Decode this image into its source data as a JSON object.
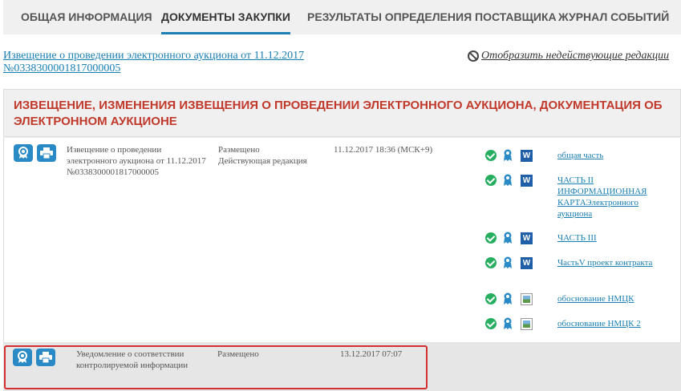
{
  "tabs": [
    {
      "label": "ОБЩАЯ ИНФОРМАЦИЯ",
      "active": false
    },
    {
      "label": "ДОКУМЕНТЫ ЗАКУПКИ",
      "active": true
    },
    {
      "label": "РЕЗУЛЬТАТЫ ОПРЕДЕЛЕНИЯ ПОСТАВЩИКА",
      "active": false
    },
    {
      "label": "ЖУРНАЛ СОБЫТИЙ",
      "active": false
    }
  ],
  "notice_link": "Извещение о проведении электронного аукциона от 11.12.2017 №0338300001817000005",
  "show_inactive": "Отобразить недействующие редакции",
  "section": {
    "title": "ИЗВЕЩЕНИЕ, ИЗМЕНЕНИЯ ИЗВЕЩЕНИЯ О ПРОВЕДЕНИИ ЭЛЕКТРОННОГО АУКЦИОНА, ДОКУМЕНТАЦИЯ ОБ ЭЛЕКТРОННОМ АУКЦИОНЕ"
  },
  "rows": [
    {
      "name": "Извещение о проведении электронного аукциона от 11.12.2017 №0338300001817000005",
      "status": "Размещено",
      "edition": "Действующая редакция",
      "date": "11.12.2017 18:36 (МСК+9)",
      "documents": [
        {
          "label": "общая часть",
          "file_icon": "word-icon",
          "file_glyph": "W"
        },
        {
          "label": "ЧАСТЬ II ИНФОРМАЦИОННАЯ КАРТАЭлектронного аукциона",
          "file_icon": "word-icon",
          "file_glyph": "W"
        },
        {
          "label": "ЧАСТЬ III",
          "file_icon": "word-icon",
          "file_glyph": "W"
        },
        {
          "label": "ЧастьV проект контракта",
          "file_icon": "word-icon",
          "file_glyph": "W"
        },
        {
          "label": "обоснование НМЦК",
          "file_icon": "image-file-icon",
          "file_glyph": ""
        },
        {
          "label": "обоснование НМЦК 2",
          "file_icon": "image-file-icon",
          "file_glyph": ""
        }
      ]
    },
    {
      "name": "Уведомление о соответствии контролируемой информации",
      "status": "Размещено",
      "date": "13.12.2017 07:07"
    }
  ],
  "colors": {
    "accent": "#1a7fb3",
    "title_red": "#c0392b",
    "highlight": "#d32f2f",
    "ok_green": "#27ae60"
  }
}
